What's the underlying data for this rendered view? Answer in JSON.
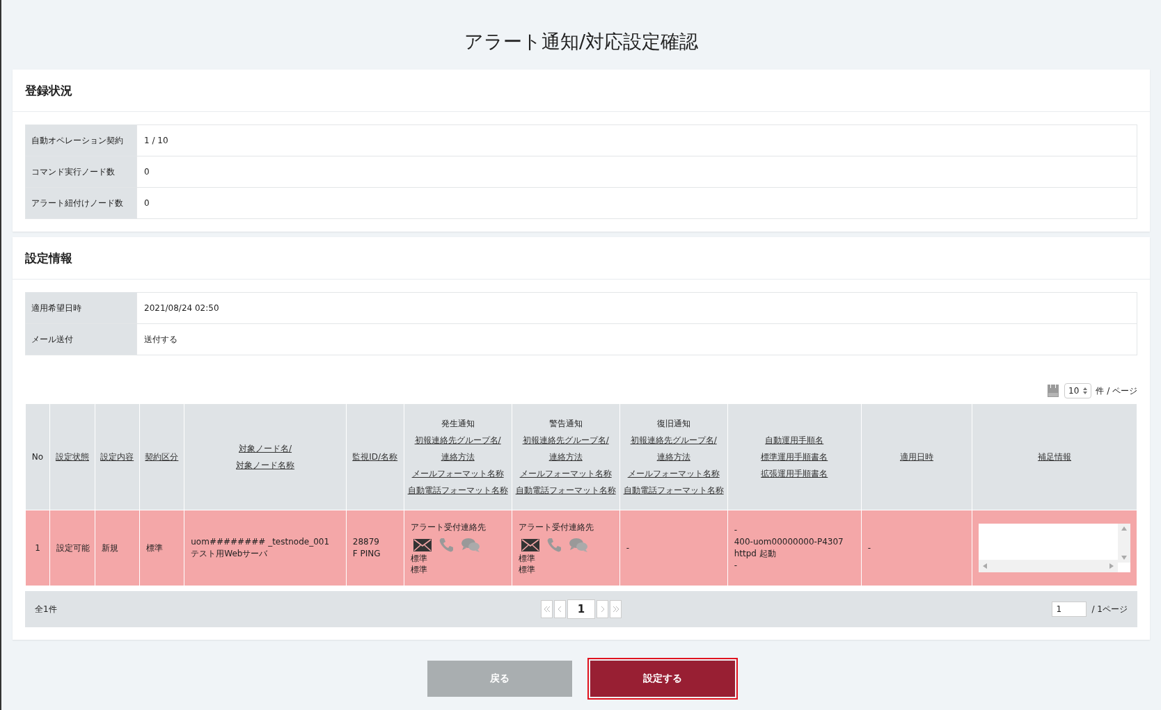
{
  "page_title": "アラート通知/対応設定確認",
  "registration": {
    "title": "登録状況",
    "rows": [
      {
        "label": "自動オペレーション契約",
        "value": "1 / 10"
      },
      {
        "label": "コマンド実行ノード数",
        "value": "0"
      },
      {
        "label": "アラート紐付けノード数",
        "value": "0"
      }
    ]
  },
  "settings": {
    "title": "設定情報",
    "rows": [
      {
        "label": "適用希望日時",
        "value": "2021/08/24 02:50"
      },
      {
        "label": "メール送付",
        "value": "送付する"
      }
    ],
    "per_page": {
      "value": "10",
      "unit": "件 / ページ"
    },
    "table": {
      "columns": [
        {
          "kind": "plain",
          "lines": [
            "No"
          ]
        },
        {
          "kind": "links",
          "lines": [
            "設定状態"
          ]
        },
        {
          "kind": "links",
          "lines": [
            "設定内容"
          ]
        },
        {
          "kind": "links",
          "lines": [
            "契約区分"
          ]
        },
        {
          "kind": "links",
          "lines": [
            "対象ノード名/",
            "対象ノード名称"
          ]
        },
        {
          "kind": "links",
          "lines": [
            "監視ID/名称"
          ]
        },
        {
          "kind": "group",
          "title": "発生通知",
          "lines": [
            "初報連絡先グループ名/",
            "連絡方法",
            "メールフォーマット名称",
            "自動電話フォーマット名称"
          ]
        },
        {
          "kind": "group",
          "title": "警告通知",
          "lines": [
            "初報連絡先グループ名/",
            "連絡方法",
            "メールフォーマット名称",
            "自動電話フォーマット名称"
          ]
        },
        {
          "kind": "group",
          "title": "復旧通知",
          "lines": [
            "初報連絡先グループ名/",
            "連絡方法",
            "メールフォーマット名称",
            "自動電話フォーマット名称"
          ]
        },
        {
          "kind": "links",
          "lines": [
            "自動運用手順名",
            "標準運用手順書名",
            "拡張運用手順書名"
          ]
        },
        {
          "kind": "links",
          "lines": [
            "適用日時"
          ]
        },
        {
          "kind": "links",
          "lines": [
            "補足情報"
          ]
        }
      ],
      "rows": [
        {
          "highlighted": true,
          "cells": [
            {
              "kind": "text",
              "lines": [
                "1"
              ]
            },
            {
              "kind": "text",
              "lines": [
                "設定可能"
              ]
            },
            {
              "kind": "text",
              "lines": [
                "新規"
              ]
            },
            {
              "kind": "text",
              "lines": [
                "標準"
              ]
            },
            {
              "kind": "text",
              "lines": [
                "uom######## _testnode_001",
                "テスト用Webサーバ"
              ]
            },
            {
              "kind": "text",
              "lines": [
                "28879",
                "F  PING"
              ]
            },
            {
              "kind": "contact",
              "title": "アラート受付連絡先",
              "methods": [
                {
                  "kind": "mail",
                  "active": true
                },
                {
                  "kind": "phone",
                  "active": false
                },
                {
                  "kind": "chat",
                  "active": false
                }
              ],
              "lines": [
                "標準",
                "標準"
              ]
            },
            {
              "kind": "contact",
              "title": "アラート受付連絡先",
              "methods": [
                {
                  "kind": "mail",
                  "active": true
                },
                {
                  "kind": "phone",
                  "active": false
                },
                {
                  "kind": "chat",
                  "active": false
                }
              ],
              "lines": [
                "標準",
                "標準"
              ]
            },
            {
              "kind": "text",
              "lines": [
                "-"
              ]
            },
            {
              "kind": "text",
              "lines": [
                "-",
                "400-uom00000000-P4307",
                "httpd 起動",
                "-"
              ]
            },
            {
              "kind": "text",
              "lines": [
                "-"
              ]
            },
            {
              "kind": "textarea"
            }
          ]
        }
      ]
    },
    "footer": {
      "total": "全1件",
      "current_page": "1",
      "page_input": "1",
      "page_total": "/  1ページ"
    }
  },
  "buttons": [
    {
      "label": "戻る",
      "kind": "secondary",
      "focused": false
    },
    {
      "label": "設定する",
      "kind": "primary",
      "focused": true
    }
  ]
}
